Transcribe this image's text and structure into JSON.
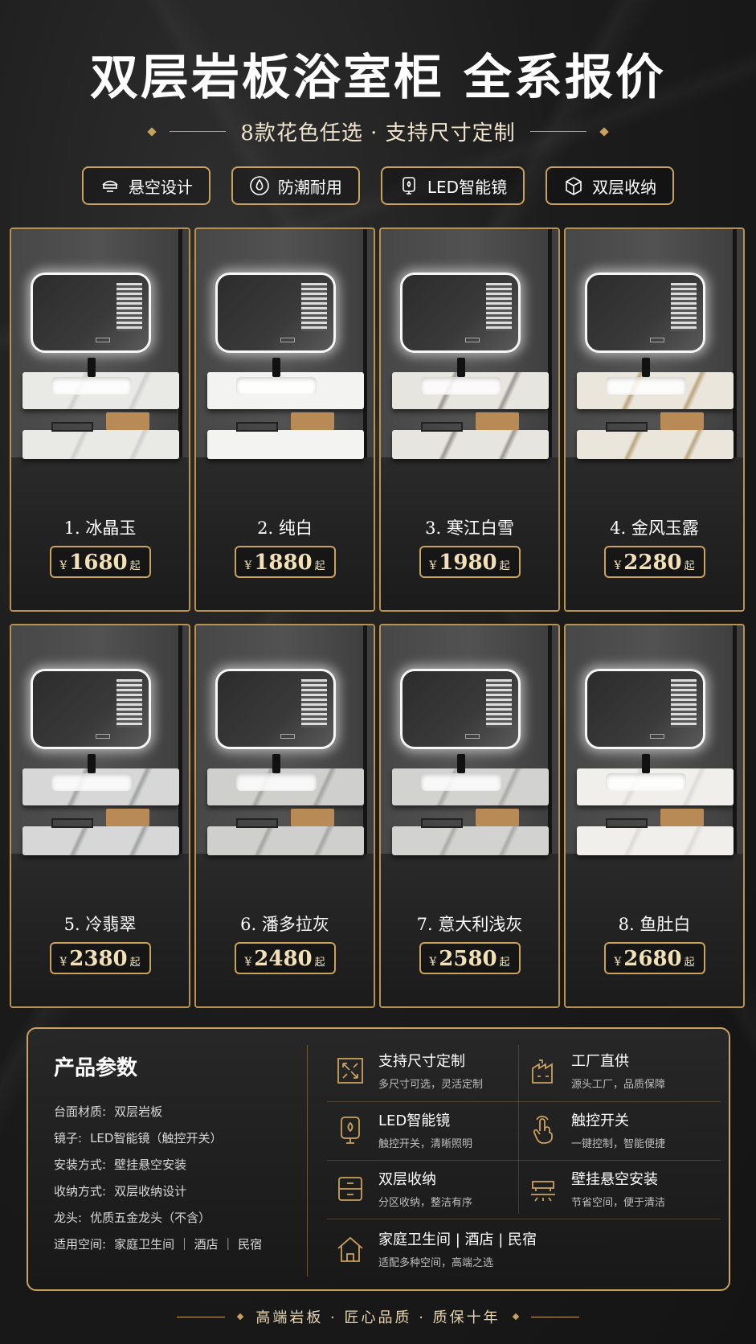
{
  "title": "双层岩板浴室柜 全系报价",
  "subtitle": "8款花色任选 · 支持尺寸定制",
  "features": [
    {
      "label": "悬空设计",
      "icon": "floating-cabinet-icon"
    },
    {
      "label": "防潮耐用",
      "icon": "water-drop-icon"
    },
    {
      "label": "LED智能镜",
      "icon": "led-mirror-icon"
    },
    {
      "label": "双层收纳",
      "icon": "storage-box-icon"
    }
  ],
  "products": [
    {
      "name": "1. 冰晶玉",
      "currency": "¥",
      "price": "1680",
      "suffix": "起",
      "stone": "#e9e9e6",
      "vein": "#cfcfcf"
    },
    {
      "name": "2. 纯白",
      "currency": "¥",
      "price": "1880",
      "suffix": "起",
      "stone": "#f3f3f1",
      "vein": "#f3f3f1"
    },
    {
      "name": "3. 寒江白雪",
      "currency": "¥",
      "price": "1980",
      "suffix": "起",
      "stone": "#e7e5e0",
      "vein": "#9a9690"
    },
    {
      "name": "4. 金风玉露",
      "currency": "¥",
      "price": "2280",
      "suffix": "起",
      "stone": "#ebe6dc",
      "vein": "#b9a57e"
    },
    {
      "name": "5. 冷翡翠",
      "currency": "¥",
      "price": "2380",
      "suffix": "起",
      "stone": "#d6d7d6",
      "vein": "#9fa2a1"
    },
    {
      "name": "6. 潘多拉灰",
      "currency": "¥",
      "price": "2480",
      "suffix": "起",
      "stone": "#cfcfcd",
      "vein": "#a4a4a2"
    },
    {
      "name": "7. 意大利浅灰",
      "currency": "¥",
      "price": "2580",
      "suffix": "起",
      "stone": "#d2d2d0",
      "vein": "#a9a9a6"
    },
    {
      "name": "8. 鱼肚白",
      "currency": "¥",
      "price": "2680",
      "suffix": "起",
      "stone": "#f0efec",
      "vein": "#dcdbd8"
    }
  ],
  "params": {
    "title": "产品参数",
    "specs": [
      {
        "key": "台面材质:",
        "value": "双层岩板"
      },
      {
        "key": "镜子:",
        "value": "LED智能镜（触控开关）"
      },
      {
        "key": "安装方式:",
        "value": "壁挂悬空安装"
      },
      {
        "key": "收纳方式:",
        "value": "双层收纳设计"
      },
      {
        "key": "龙头:",
        "value": "优质五金龙头（不含）"
      },
      {
        "key": "适用空间:",
        "value": "家庭卫生间 ｜ 酒店 ｜ 民宿"
      }
    ],
    "items": [
      {
        "title": "支持尺寸定制",
        "sub": "多尺寸可选，灵活定制",
        "icon": "resize-icon"
      },
      {
        "title": "工厂直供",
        "sub": "源头工厂，品质保障",
        "icon": "factory-icon"
      },
      {
        "title": "LED智能镜",
        "sub": "触控开关，清晰照明",
        "icon": "led-mirror-icon"
      },
      {
        "title": "触控开关",
        "sub": "一键控制，智能便捷",
        "icon": "touch-hand-icon"
      },
      {
        "title": "双层收纳",
        "sub": "分区收纳，整洁有序",
        "icon": "storage-box-icon"
      },
      {
        "title": "壁挂悬空安装",
        "sub": "节省空间，便于清洁",
        "icon": "wall-mount-icon"
      },
      {
        "title": "家庭卫生间 | 酒店 | 民宿",
        "sub": "适配多种空间，高端之选",
        "icon": "house-icon"
      }
    ]
  },
  "footer": "高端岩板 · 匠心品质 · 质保十年",
  "colors": {
    "gold": "#c9a25b",
    "background": "#1c1c1c"
  }
}
